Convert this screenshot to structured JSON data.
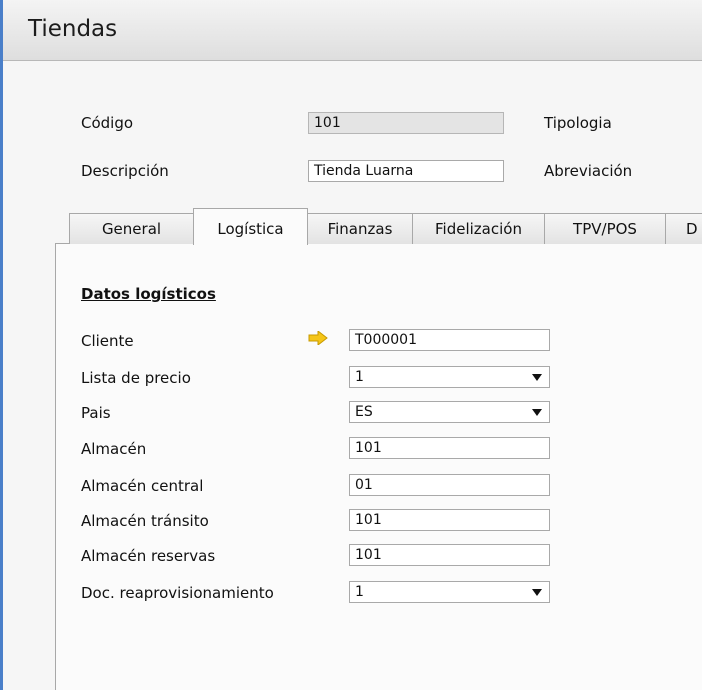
{
  "window": {
    "title": "Tiendas"
  },
  "header": {
    "codigo_label": "Código",
    "codigo_value": "101",
    "tipologia_label": "Tipologia",
    "descripcion_label": "Descripción",
    "descripcion_value": "Tienda Luarna",
    "abreviacion_label": "Abreviación"
  },
  "tabs": [
    "General",
    "Logística",
    "Finanzas",
    "Fidelización",
    "TPV/POS",
    "D"
  ],
  "active_tab": "Logística",
  "section": {
    "title": "Datos logísticos"
  },
  "fields": [
    {
      "label": "Cliente",
      "value": "T000001",
      "type": "link"
    },
    {
      "label": "Lista de precio",
      "value": "1",
      "type": "select"
    },
    {
      "label": "Pais",
      "value": "ES",
      "type": "select"
    },
    {
      "label": "Almacén",
      "value": "101",
      "type": "text"
    },
    {
      "label": "Almacén central",
      "value": "01",
      "type": "text"
    },
    {
      "label": "Almacén tránsito",
      "value": "101",
      "type": "text"
    },
    {
      "label": "Almacén reservas",
      "value": "101",
      "type": "text"
    },
    {
      "label": "Doc. reaprovisionamiento",
      "value": "1",
      "type": "select"
    }
  ],
  "icons": {
    "link_arrow": "link-arrow-icon",
    "dropdown": "chevron-down-icon"
  },
  "colors": {
    "link_arrow": "#f5c518",
    "window_accent": "#4a7fc9"
  }
}
